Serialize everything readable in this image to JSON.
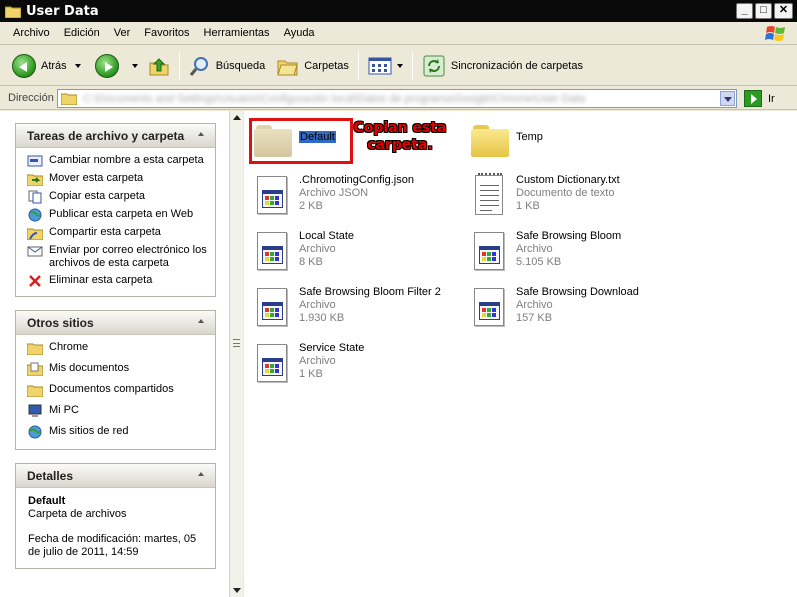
{
  "window": {
    "title": "User Data"
  },
  "menu": [
    "Archivo",
    "Edición",
    "Ver",
    "Favoritos",
    "Herramientas",
    "Ayuda"
  ],
  "toolbar": {
    "back_label": "Atrás",
    "search_label": "Búsqueda",
    "folders_label": "Carpetas",
    "sync_label": "Sincronización de carpetas"
  },
  "address": {
    "label": "Dirección",
    "value": "C:\\Documents and Settings\\Usuario\\Configuración local\\Datos de programa\\Google\\Chrome\\User Data",
    "go_label": "Ir"
  },
  "tasks_panel": {
    "title": "Tareas de archivo y carpeta",
    "items": [
      "Cambiar nombre a esta carpeta",
      "Mover esta carpeta",
      "Copiar esta carpeta",
      "Publicar esta carpeta en Web",
      "Compartir esta carpeta",
      "Enviar por correo electrónico los archivos de esta carpeta",
      "Eliminar esta carpeta"
    ]
  },
  "places_panel": {
    "title": "Otros sitios",
    "items": [
      "Chrome",
      "Mis documentos",
      "Documentos compartidos",
      "Mi PC",
      "Mis sitios de red"
    ]
  },
  "details_panel": {
    "title": "Detalles",
    "name": "Default",
    "type": "Carpeta de archivos",
    "modified": "Fecha de modificación: martes, 05 de julio de 2011, 14:59"
  },
  "files": [
    {
      "name": "Default",
      "type": "",
      "size": "",
      "kind": "folder"
    },
    {
      "name": "Temp",
      "type": "",
      "size": "",
      "kind": "folder"
    },
    {
      "name": ".ChromotingConfig.json",
      "type": "Archivo JSON",
      "size": "2 KB",
      "kind": "file"
    },
    {
      "name": "Custom Dictionary.txt",
      "type": "Documento de texto",
      "size": "1 KB",
      "kind": "text"
    },
    {
      "name": "Local State",
      "type": "Archivo",
      "size": "8 KB",
      "kind": "file"
    },
    {
      "name": "Safe Browsing Bloom",
      "type": "Archivo",
      "size": "5.105 KB",
      "kind": "file"
    },
    {
      "name": "Safe Browsing Bloom Filter 2",
      "type": "Archivo",
      "size": "1.930 KB",
      "kind": "file"
    },
    {
      "name": "Safe Browsing Download",
      "type": "Archivo",
      "size": "157 KB",
      "kind": "file"
    },
    {
      "name": "Service State",
      "type": "Archivo",
      "size": "1 KB",
      "kind": "file"
    }
  ],
  "annotation": {
    "text": "Copian esta carpeta."
  },
  "colors": {
    "selection": "#316ac5",
    "annotation": "#e00000",
    "folder": "#e8d47a"
  }
}
